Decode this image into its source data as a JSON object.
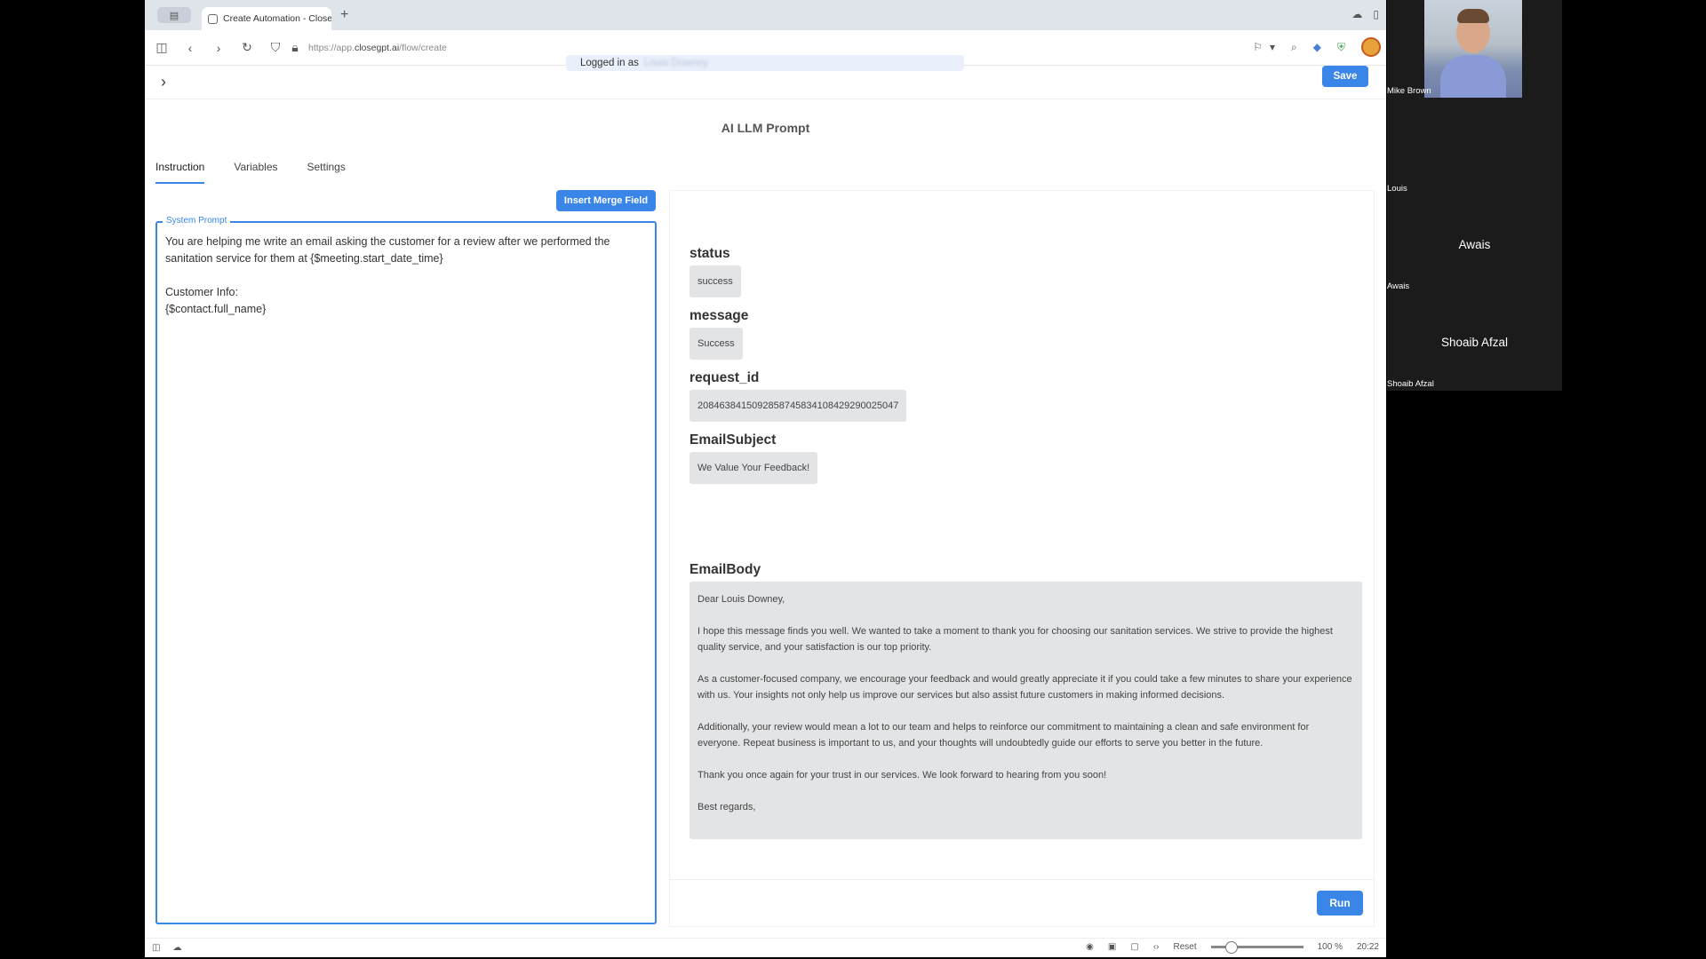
{
  "browser": {
    "tab_title": "Create Automation - Close",
    "new_tab": "+",
    "url_prefix": "https://app.",
    "url_domain": "closegpt.ai",
    "url_path": "/flow/create"
  },
  "app": {
    "login_banner": "Logged in as",
    "login_user": "Louis Downey",
    "save_label": "Save",
    "page_title": "AI LLM Prompt",
    "tabs": [
      {
        "label": "Instruction",
        "active": true
      },
      {
        "label": "Variables",
        "active": false
      },
      {
        "label": "Settings",
        "active": false
      }
    ],
    "insert_merge_field_label": "Insert Merge Field",
    "system_prompt": {
      "legend": "System Prompt",
      "text": "You are helping me write an email asking the customer for a review after we performed the sanitation service for them at {$meeting.start_date_time}\n\nCustomer Info:\n{$contact.full_name}"
    },
    "output": {
      "status": {
        "label": "status",
        "value": "success"
      },
      "message": {
        "label": "message",
        "value": "Success"
      },
      "request_id": {
        "label": "request_id",
        "value": "2084638415092858745834108429290025047"
      },
      "email_subject": {
        "label": "EmailSubject",
        "value": "We Value Your Feedback!"
      },
      "email_body": {
        "label": "EmailBody",
        "paragraphs": [
          "Dear Louis Downey,",
          "I hope this message finds you well. We wanted to take a moment to thank you for choosing our sanitation services. We strive to provide the highest quality service, and your satisfaction is our top priority.",
          "As a customer-focused company, we encourage your feedback and would greatly appreciate it if you could take a few minutes to share your experience with us. Your insights not only help us improve our services but also assist future customers in making informed decisions.",
          "Additionally, your review would mean a lot to our team and helps to reinforce our commitment to maintaining a clean and safe environment for everyone. Repeat business is important to us, and your thoughts will undoubtedly guide our efforts to serve you better in the future.",
          "Thank you once again for your trust in our services. We look forward to hearing from you soon!",
          "Best regards,"
        ]
      }
    },
    "run_label": "Run"
  },
  "statusbar": {
    "reset_label": "Reset",
    "zoom": "100 %",
    "time": "20:22"
  },
  "participants": [
    {
      "name": "Mike Brown",
      "has_video": true
    },
    {
      "name": "Louis",
      "has_video": false,
      "center": ""
    },
    {
      "name": "Awais",
      "has_video": false,
      "center": "Awais"
    },
    {
      "name": "Shoaib Afzal",
      "has_video": false,
      "center": "Shoaib Afzal"
    }
  ],
  "colors": {
    "accent": "#3a86e8",
    "output_field_bg": "#e3e4e6"
  }
}
